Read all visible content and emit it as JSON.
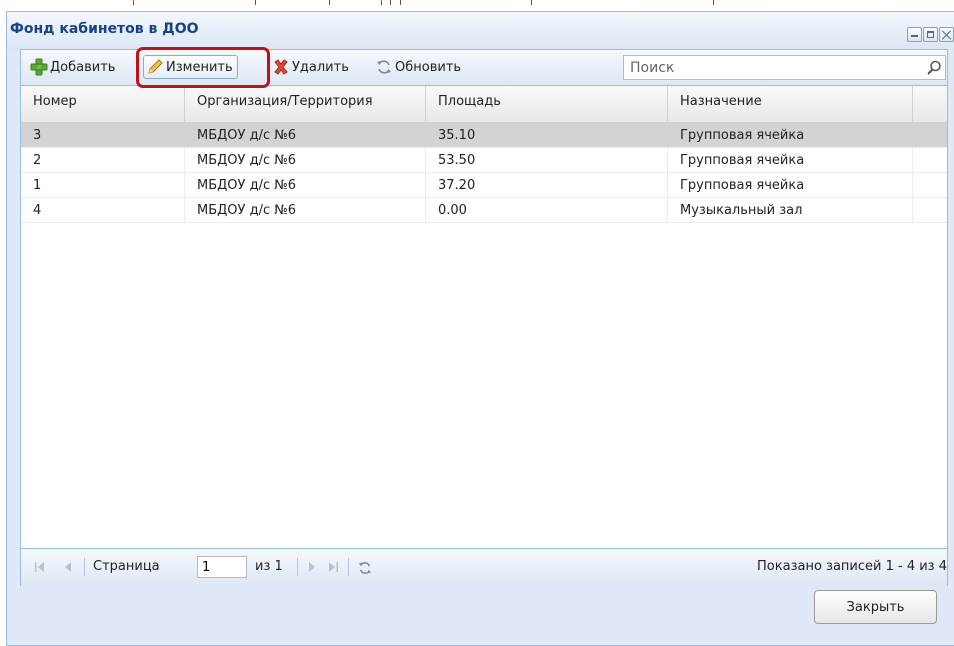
{
  "window": {
    "title": "Фонд кабинетов в ДОО"
  },
  "toolbar": {
    "add_label": "Добавить",
    "edit_label": "Изменить",
    "delete_label": "Удалить",
    "refresh_label": "Обновить",
    "search_placeholder": "Поиск",
    "icons": {
      "add": "plus-icon",
      "edit": "pencil-icon",
      "delete": "delete-icon",
      "refresh": "refresh-icon",
      "search": "search-icon"
    }
  },
  "grid": {
    "columns": [
      "Номер",
      "Организация/Территория",
      "Площадь",
      "Назначение"
    ],
    "rows": [
      [
        "3",
        "МБДОУ д/с №6",
        "35.10",
        "Групповая ячейка"
      ],
      [
        "2",
        "МБДОУ д/с №6",
        "53.50",
        "Групповая ячейка"
      ],
      [
        "1",
        "МБДОУ д/с №6",
        "37.20",
        "Групповая ячейка"
      ],
      [
        "4",
        "МБДОУ д/с №6",
        "0.00",
        "Музыкальный зал"
      ]
    ],
    "selected_row": 0
  },
  "pager": {
    "page_label": "Страница",
    "page_value": "1",
    "of_label": "из 1",
    "summary": "Показано записей 1 - 4 из 4"
  },
  "footer": {
    "close_label": "Закрыть"
  },
  "colors": {
    "highlight": "#c0101a",
    "title": "#15428b",
    "selected_row": "#d3d3d3"
  }
}
